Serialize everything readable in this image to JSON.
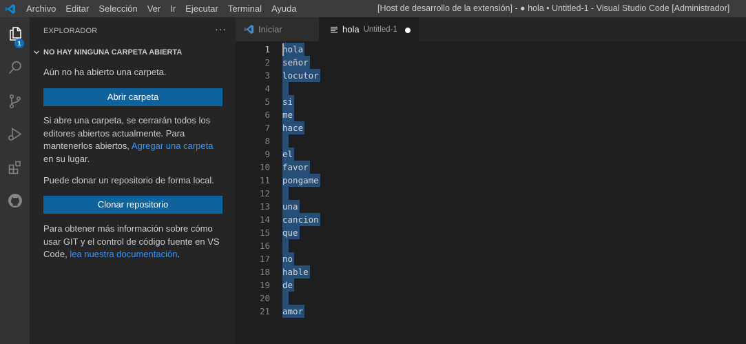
{
  "titlebar": {
    "menu": [
      "Archivo",
      "Editar",
      "Selección",
      "Ver",
      "Ir",
      "Ejecutar",
      "Terminal",
      "Ayuda"
    ],
    "window_title": "[Host de desarrollo de la extensión] - ● hola • Untitled-1 - Visual Studio Code [Administrador]"
  },
  "activitybar": {
    "explorer_badge": "1",
    "icons": [
      "files-icon",
      "search-icon",
      "source-control-icon",
      "run-debug-icon",
      "extensions-icon",
      "github-icon"
    ]
  },
  "sidebar": {
    "title": "EXPLORADOR",
    "more": "···",
    "section": "NO HAY NINGUNA CARPETA ABIERTA",
    "no_folder_text": "Aún no ha abierto una carpeta.",
    "open_folder_button": "Abrir carpeta",
    "close_editors_text_1": "Si abre una carpeta, se cerrarán todos los editores abiertos actualmente. Para mantenerlos abiertos,",
    "close_editors_link": "Agregar una carpeta",
    "close_editors_text_2": "en su lugar.",
    "clone_text": "Puede clonar un repositorio de forma local.",
    "clone_button": "Clonar repositorio",
    "git_text_1": "Para obtener más información sobre cómo usar GIT y el control de código fuente en VS Code,",
    "git_link": "lea nuestra documentación",
    "git_text_2": "."
  },
  "tabs": {
    "inactive_label": "Iniciar",
    "active_label": "hola",
    "active_description": "Untitled-1"
  },
  "editor": {
    "lines": [
      "hola",
      "señor",
      "locutor",
      "",
      "si",
      "me",
      "hace",
      "",
      "el",
      "favor",
      "pongame",
      "",
      "una",
      "cancion",
      "que",
      "",
      "no",
      "hable",
      "de",
      "",
      "amor"
    ],
    "line_numbers": [
      "1",
      "2",
      "3",
      "4",
      "5",
      "6",
      "7",
      "8",
      "9",
      "10",
      "11",
      "12",
      "13",
      "14",
      "15",
      "16",
      "17",
      "18",
      "19",
      "20",
      "21"
    ]
  },
  "colors": {
    "accent": "#0e639c",
    "selection": "#264f78",
    "badge": "#0e70c0",
    "link": "#3794ff"
  }
}
